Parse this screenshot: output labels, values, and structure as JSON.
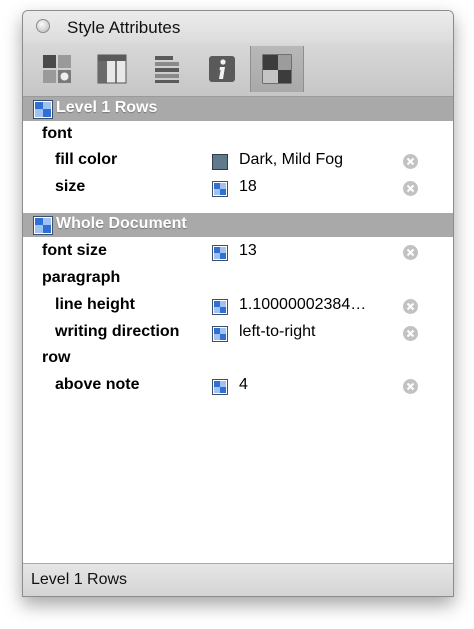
{
  "window": {
    "title": "Style Attributes"
  },
  "toolbar": {
    "buttons": [
      {
        "name": "style-attributes-icon",
        "selected": false
      },
      {
        "name": "columns-icon",
        "selected": false
      },
      {
        "name": "rows-icon",
        "selected": false
      },
      {
        "name": "info-icon",
        "selected": false,
        "glyph": "i"
      },
      {
        "name": "layout-icon",
        "selected": true
      }
    ]
  },
  "groups": [
    {
      "label": "Level 1 Rows",
      "rows": [
        {
          "prop": "font",
          "indent": 0
        },
        {
          "prop": "fill color",
          "indent": 1,
          "swatch": "color",
          "swatch_color": "#5f7a8b",
          "value": "Dark, Mild Fog",
          "removable": true
        },
        {
          "prop": "size",
          "indent": 1,
          "swatch": "style",
          "value": "18",
          "removable": true
        }
      ]
    },
    {
      "label": "Whole Document",
      "rows": [
        {
          "prop": "font size",
          "indent": 0,
          "swatch": "style",
          "value": "13",
          "removable": true
        },
        {
          "prop": "paragraph",
          "indent": 0
        },
        {
          "prop": "line height",
          "indent": 1,
          "swatch": "style",
          "value": "1.10000002384…",
          "removable": true
        },
        {
          "prop": "writing direction",
          "indent": 1,
          "swatch": "style",
          "value": "left-to-right",
          "removable": true
        },
        {
          "prop": "row",
          "indent": 0
        },
        {
          "prop": "above note",
          "indent": 1,
          "swatch": "style",
          "value": "4",
          "removable": true
        }
      ]
    }
  ],
  "status": {
    "text": "Level 1 Rows"
  },
  "colors": {
    "group_header": "#a9a9a9",
    "style_blue": "#2f6fd6"
  }
}
